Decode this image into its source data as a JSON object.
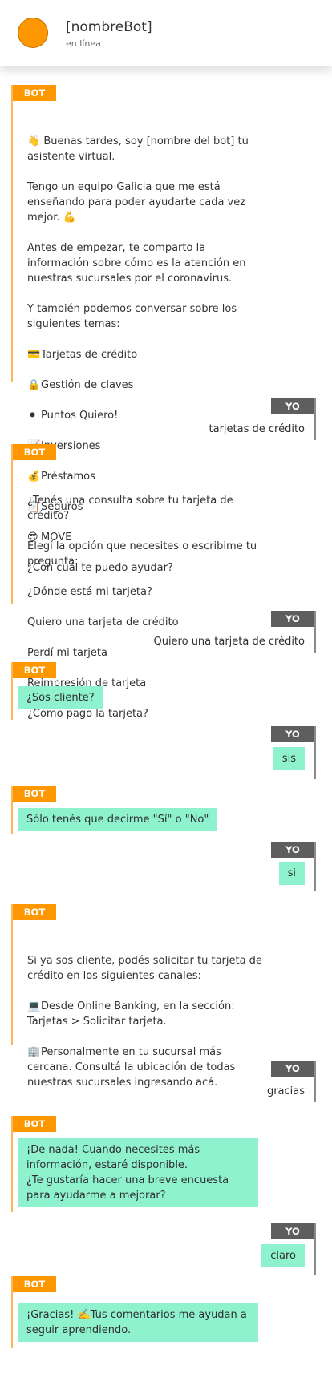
{
  "header": {
    "title": "[nombreBot]",
    "status": "en línea"
  },
  "labels": {
    "bot": "BOT",
    "user": "YO"
  },
  "m1": {
    "greeting": "👋 Buenas tardes, soy [nombre del bot] tu asistente virtual.",
    "l2": "Tengo un equipo Galicia que me está enseñando para poder ayudarte cada vez mejor. 💪",
    "l3": "Antes de empezar, te comparto la información sobre cómo es la atención en nuestras sucursales por el coronavirus.",
    "l4": "Y también podemos conversar sobre los siguientes temas:",
    "topics": [
      {
        "icon": "credit-card-icon",
        "glyph": "💳",
        "label": "Tarjetas de crédito"
      },
      {
        "icon": "lock-icon",
        "glyph": "🔒",
        "label": "Gestión de claves"
      },
      {
        "icon": "circle-icon",
        "glyph": "⚫",
        "label": "Puntos Quiero!"
      },
      {
        "icon": "chart-icon",
        "glyph": "📈",
        "label": "Inversiones"
      },
      {
        "icon": "money-bag-icon",
        "glyph": "💰",
        "label": "Préstamos"
      },
      {
        "icon": "clipboard-icon",
        "glyph": "📋",
        "label": "Seguros"
      },
      {
        "icon": "sunglasses-icon",
        "glyph": "😎",
        "label": "MOVE"
      }
    ],
    "question": "¿Con cuál te puedo ayudar?"
  },
  "u1": "tarjetas de crédito",
  "m2": {
    "l1": "¿Tenés una consulta sobre tu tarjeta de crédito?",
    "l2": "Elegí la opción que necesites o escribime tu pregunta:",
    "options": [
      "¿Dónde está mi tarjeta?",
      "Quiero una tarjeta de crédito",
      "Perdí mi tarjeta",
      "Reimpresión de tarjeta",
      "¿Cómo pago la tarjeta?"
    ]
  },
  "u2": "Quiero una tarjeta de crédito",
  "m3": "¿Sos cliente?",
  "u3": "sis",
  "m4": "Sólo tenés que decirme \"Sí\" o \"No\"",
  "u4": "si",
  "m5": {
    "l1": "Si ya sos cliente, podés solicitar tu tarjeta de crédito en los siguientes canales:",
    "l2_icon": "💻",
    "l2": "Desde Online Banking, en la sección: Tarjetas > Solicitar tarjeta.",
    "l3_icon": "🏢",
    "l3": "Personalmente en tu sucursal más cercana. Consultá la ubicación de todas nuestras sucursales ingresando acá."
  },
  "u5": "gracias",
  "m6": "¡De nada! Cuando necesites más información, estaré disponible.\n¿Te gustaría hacer una breve encuesta para ayudarme a mejorar?",
  "u6": "claro",
  "m7": "¡Gracias! ✍️Tus comentarios me ayudan a seguir aprendiendo."
}
